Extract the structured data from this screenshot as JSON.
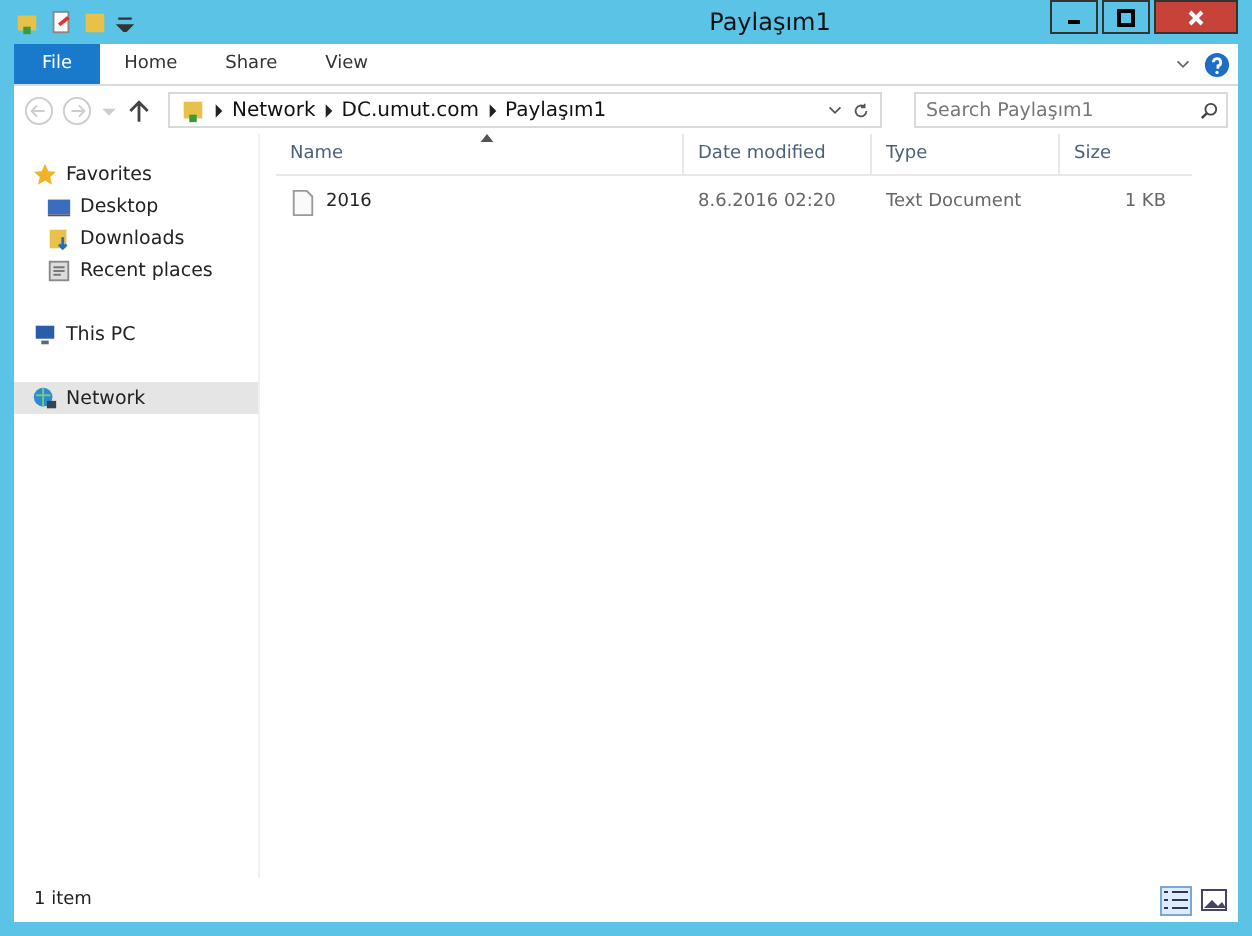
{
  "window": {
    "title": "Paylaşım1"
  },
  "ribbon_tabs": [
    {
      "label": "File",
      "selected": true
    },
    {
      "label": "Home",
      "selected": false
    },
    {
      "label": "Share",
      "selected": false
    },
    {
      "label": "View",
      "selected": false
    }
  ],
  "address_bar": {
    "path": [
      "Network",
      "DC.umut.com",
      "Paylaşım1"
    ]
  },
  "search": {
    "placeholder": "Search Paylaşım1"
  },
  "sidebar": {
    "groups": [
      {
        "label": "Favorites",
        "kind": "favorites",
        "selected": false,
        "children": [
          {
            "label": "Desktop",
            "kind": "desktop",
            "selected": false
          },
          {
            "label": "Downloads",
            "kind": "downloads",
            "selected": false
          },
          {
            "label": "Recent places",
            "kind": "recent",
            "selected": false
          }
        ]
      },
      {
        "label": "This PC",
        "kind": "pc",
        "selected": false
      },
      {
        "label": "Network",
        "kind": "network",
        "selected": true
      }
    ]
  },
  "table": {
    "columns": [
      "Name",
      "Date modified",
      "Type",
      "Size"
    ],
    "rows": [
      {
        "name": "2016",
        "date_modified": "8.6.2016 02:20",
        "type": "Text Document",
        "size": "1 KB"
      }
    ]
  },
  "status_bar": {
    "text": "1 item"
  }
}
